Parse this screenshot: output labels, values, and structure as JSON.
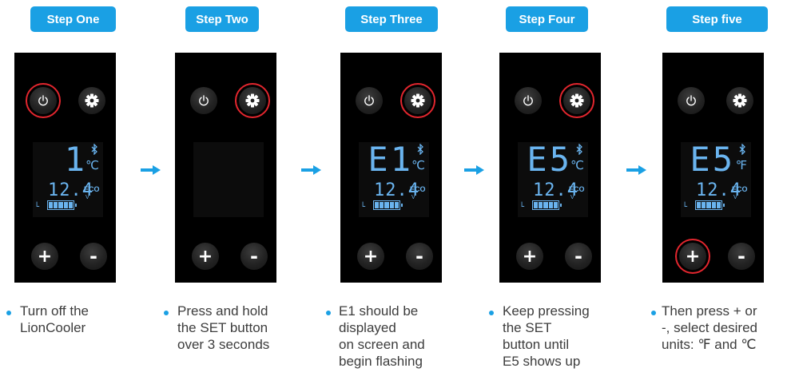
{
  "steps": [
    {
      "tab_label": "Step One",
      "highlight": "power",
      "display": {
        "main": "1",
        "unit": "℃",
        "reading": "12.4",
        "eco": "ECO",
        "volt": "V"
      },
      "power_icon": "power-icon",
      "set_icon": "gear-icon",
      "plus_label": "+",
      "minus_label": "-",
      "caption_lines": [
        "Turn off the",
        "LionCooler"
      ]
    },
    {
      "tab_label": "Step Two",
      "highlight": "set",
      "display": null,
      "power_icon": "power-icon",
      "set_icon": "gear-icon",
      "plus_label": "+",
      "minus_label": "-",
      "caption_lines": [
        "Press and hold",
        "the SET button",
        "over 3 seconds"
      ]
    },
    {
      "tab_label": "Step Three",
      "highlight": "set",
      "display": {
        "main": "E1",
        "unit": "℃",
        "reading": "12.4",
        "eco": "ECO",
        "volt": "V"
      },
      "power_icon": "power-icon",
      "set_icon": "gear-icon",
      "plus_label": "+",
      "minus_label": "-",
      "caption_lines": [
        "E1 should be",
        "displayed",
        "on screen and",
        "begin flashing"
      ]
    },
    {
      "tab_label": "Step Four",
      "highlight": "set",
      "display": {
        "main": "E5",
        "unit": "℃",
        "reading": "12.4",
        "eco": "ECO",
        "volt": "V"
      },
      "power_icon": "power-icon",
      "set_icon": "gear-icon",
      "plus_label": "+",
      "minus_label": "-",
      "caption_lines": [
        "Keep pressing",
        "the SET",
        "button until",
        "E5 shows up"
      ]
    },
    {
      "tab_label": "Step five",
      "highlight": "plus",
      "display": {
        "main": "E5",
        "unit": "℉",
        "reading": "12.4",
        "eco": "ECO",
        "volt": "V"
      },
      "power_icon": "power-icon",
      "set_icon": "gear-icon",
      "plus_label": "+",
      "minus_label": "-",
      "caption_lines": [
        "Then press + or",
        "-, select desired",
        "units: ℉ and ℃"
      ]
    }
  ],
  "colors": {
    "accent": "#1aa0e4",
    "highlight_ring": "#e2262e",
    "lcd_text": "#6ab4ef",
    "caption_text": "#3d3d3d"
  }
}
